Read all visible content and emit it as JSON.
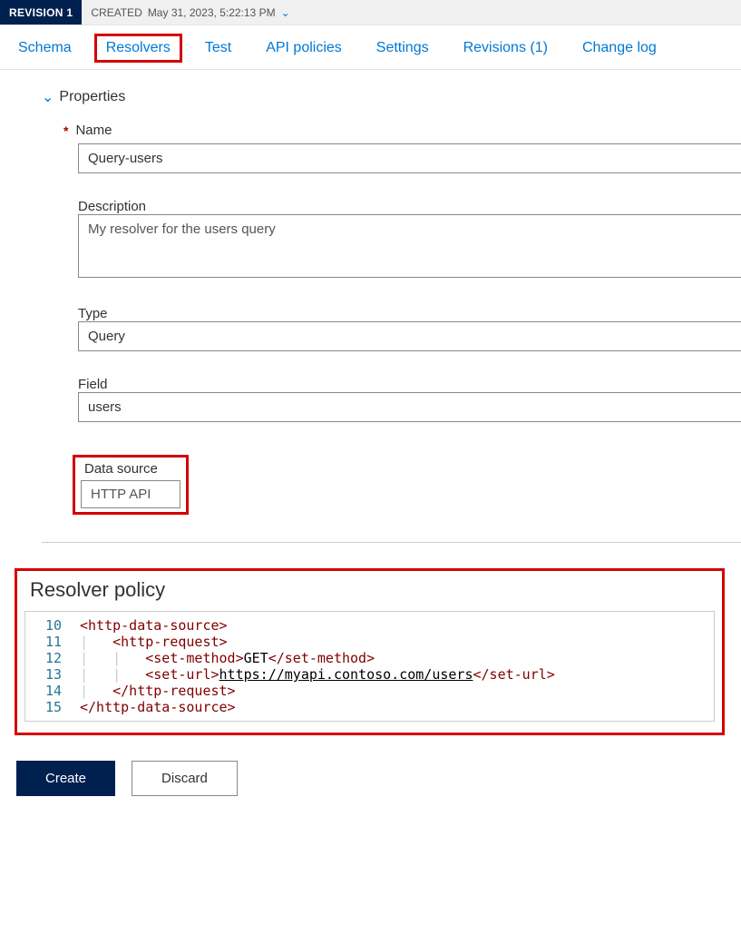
{
  "revision": {
    "badge": "REVISION 1",
    "created_label": "CREATED",
    "created_value": "May 31, 2023, 5:22:13 PM"
  },
  "tabs": {
    "schema": "Schema",
    "resolvers": "Resolvers",
    "test": "Test",
    "api_policies": "API policies",
    "settings": "Settings",
    "revisions": "Revisions (1)",
    "change_log": "Change log"
  },
  "section": {
    "properties": "Properties"
  },
  "fields": {
    "name_label": "Name",
    "name_value": "Query-users",
    "description_label": "Description",
    "description_value": "My resolver for the users query",
    "type_label": "Type",
    "type_value": "Query",
    "field_label": "Field",
    "field_value": "users",
    "data_source_label": "Data source",
    "data_source_value": "HTTP API"
  },
  "policy": {
    "title": "Resolver policy",
    "lines": [
      {
        "n": "10",
        "indent": "",
        "open": "<http-data-source>",
        "mid": "",
        "close": ""
      },
      {
        "n": "11",
        "indent": "    ",
        "open": "<http-request>",
        "mid": "",
        "close": ""
      },
      {
        "n": "12",
        "indent": "        ",
        "open": "<set-method>",
        "mid": "GET",
        "close": "</set-method>"
      },
      {
        "n": "13",
        "indent": "        ",
        "open": "<set-url>",
        "mid_url": "https://myapi.contoso.com/users",
        "close": "</set-url>"
      },
      {
        "n": "14",
        "indent": "    ",
        "open": "</http-request>",
        "mid": "",
        "close": ""
      },
      {
        "n": "15",
        "indent": "",
        "open": "</http-data-source>",
        "mid": "",
        "close": ""
      }
    ]
  },
  "buttons": {
    "create": "Create",
    "discard": "Discard"
  }
}
